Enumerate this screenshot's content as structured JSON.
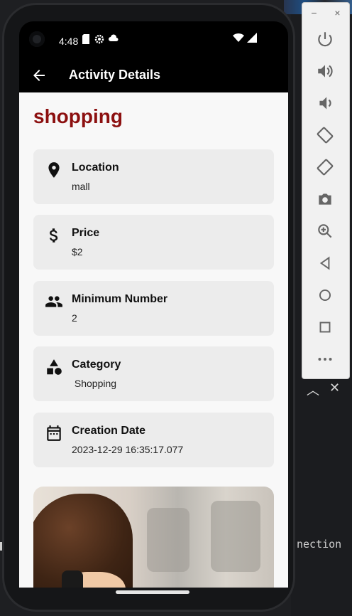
{
  "status_bar": {
    "time": "4:48"
  },
  "app_bar": {
    "title": "Activity Details"
  },
  "activity": {
    "name": "shopping",
    "details": [
      {
        "label": "Location",
        "value": "mall",
        "icon": "location-pin-icon"
      },
      {
        "label": "Price",
        "value": "$2",
        "icon": "dollar-icon"
      },
      {
        "label": "Minimum Number",
        "value": "2",
        "icon": "people-icon"
      },
      {
        "label": "Category",
        "value": " Shopping",
        "icon": "category-shapes-icon"
      },
      {
        "label": "Creation Date",
        "value": "2023-12-29 16:35:17.077",
        "icon": "calendar-icon"
      }
    ]
  },
  "colors": {
    "heading": "#8c1010",
    "card_bg": "#ececec",
    "screen_bg": "#f8f8f8"
  },
  "emulator_panel": {
    "buttons": [
      "power-icon",
      "volume-up-icon",
      "volume-down-icon",
      "rotate-left-icon",
      "rotate-right-icon",
      "camera-icon",
      "zoom-icon",
      "back-icon",
      "home-icon",
      "overview-icon",
      "more-icon"
    ]
  },
  "background": {
    "ide_text": "nection"
  }
}
